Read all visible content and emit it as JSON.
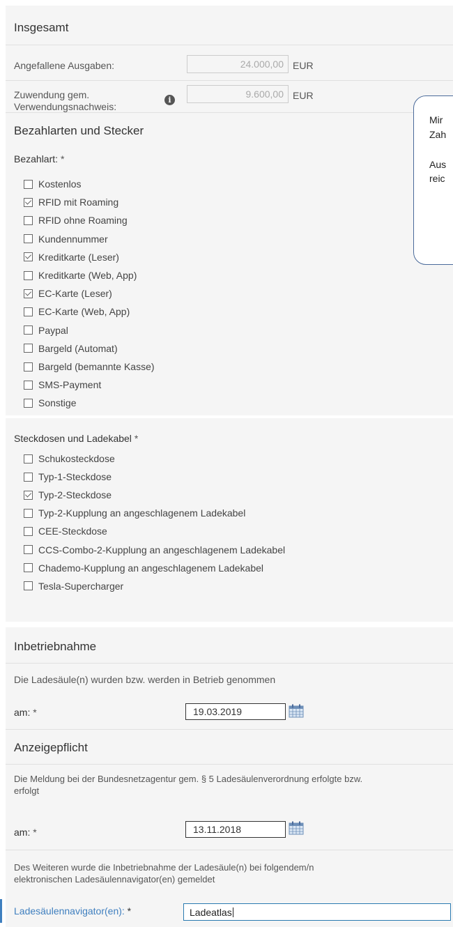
{
  "insgesamt": {
    "title": "Insgesamt",
    "ausgaben_label": "Angefallene Ausgaben:",
    "ausgaben_value": "24.000,00",
    "ausgaben_unit": "EUR",
    "zuwendung_label_1": "Zuwendung gem.",
    "zuwendung_label_2": "Verwendungsnachweis:",
    "zuwendung_value": "9.600,00",
    "zuwendung_unit": "EUR",
    "info_icon": "i"
  },
  "bezahl": {
    "title": "Bezahlarten und Stecker",
    "label": "Bezahlart:",
    "required": "*",
    "options": [
      {
        "label": "Kostenlos",
        "checked": false
      },
      {
        "label": "RFID mit Roaming",
        "checked": true
      },
      {
        "label": "RFID ohne Roaming",
        "checked": false
      },
      {
        "label": "Kundennummer",
        "checked": false
      },
      {
        "label": "Kreditkarte (Leser)",
        "checked": true
      },
      {
        "label": "Kreditkarte (Web, App)",
        "checked": false
      },
      {
        "label": "EC-Karte (Leser)",
        "checked": true
      },
      {
        "label": "EC-Karte (Web, App)",
        "checked": false
      },
      {
        "label": "Paypal",
        "checked": false
      },
      {
        "label": "Bargeld (Automat)",
        "checked": false
      },
      {
        "label": "Bargeld (bemannte Kasse)",
        "checked": false
      },
      {
        "label": "SMS-Payment",
        "checked": false
      },
      {
        "label": "Sonstige",
        "checked": false
      }
    ]
  },
  "stecker": {
    "label": "Steckdosen und Ladekabel",
    "required": "*",
    "options": [
      {
        "label": "Schukosteckdose",
        "checked": false
      },
      {
        "label": "Typ-1-Steckdose",
        "checked": false
      },
      {
        "label": "Typ-2-Steckdose",
        "checked": true
      },
      {
        "label": "Typ-2-Kupplung an angeschlagenem Ladekabel",
        "checked": false
      },
      {
        "label": "CEE-Steckdose",
        "checked": false
      },
      {
        "label": "CCS-Combo-2-Kupplung an angeschlagenem Ladekabel",
        "checked": false
      },
      {
        "label": "Chademo-Kupplung an angeschlagenem Ladekabel",
        "checked": false
      },
      {
        "label": "Tesla-Supercharger",
        "checked": false
      }
    ]
  },
  "inbetrieb": {
    "title": "Inbetriebnahme",
    "text": "Die Ladesäule(n) wurden bzw. werden in Betrieb genommen",
    "am_label": "am:",
    "required": "*",
    "date": "19.03.2019"
  },
  "anzeige": {
    "title": "Anzeigepflicht",
    "text_1": "Die Meldung bei der Bundesnetzagentur gem. § 5 Ladesäulenverordnung erfolgte bzw.",
    "text_2": "erfolgt",
    "am_label": "am:",
    "required": "*",
    "date": "13.11.2018",
    "text2_1": "Des Weiteren wurde die Inbetriebnahme der Ladesäule(n) bei folgendem/n",
    "text2_2": "elektronischen Ladesäulennavigator(en) gemeldet",
    "nav_label": "Ladesäulennavigator(en):",
    "nav_value": "Ladeatlas"
  },
  "callout": {
    "line1": "Mir",
    "line2": "Zah",
    "line3": "Aus",
    "line4": "reic"
  },
  "colors": {
    "accent": "#3f7fbf",
    "panel": "#f5f5f5"
  }
}
